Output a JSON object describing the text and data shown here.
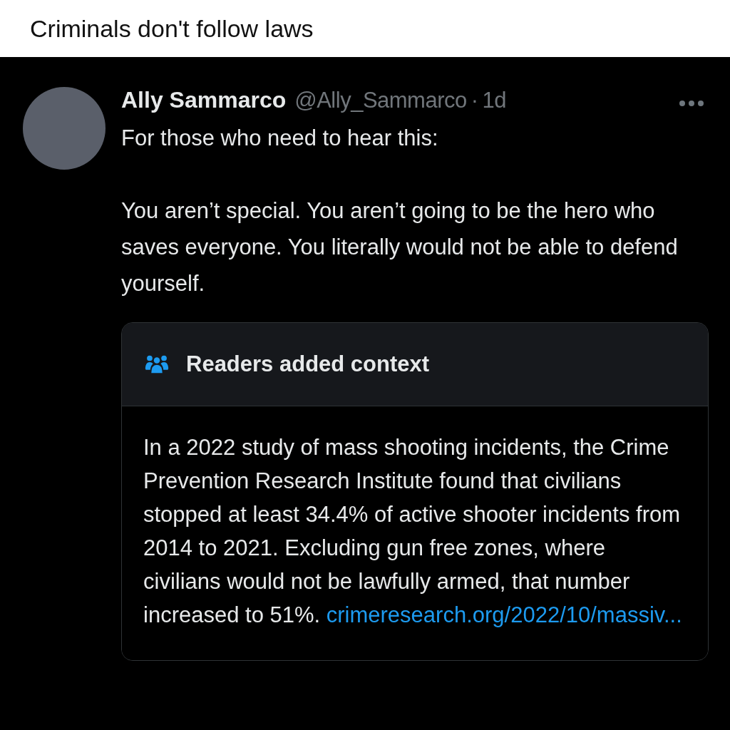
{
  "post": {
    "title": "Criminals don't follow laws"
  },
  "tweet": {
    "author": "Ally Sammarco",
    "handle": "@Ally_Sammarco",
    "separator": "·",
    "time": "1d",
    "paragraphs": [
      "For those who need to hear this:",
      "You aren’t special. You aren’t going to be the hero who saves everyone. You literally would not be able to defend yourself."
    ]
  },
  "community_note": {
    "heading": "Readers added context",
    "text": "In a 2022 study of mass shooting incidents, the Crime Prevention Research Institute found that civilians stopped at least 34.4% of active shooter incidents from 2014 to 2021. Excluding gun free zones, where civilians would not be lawfully armed, that number increased to 51%.",
    "link": "crimeresearch.org/2022/10/massiv..."
  }
}
